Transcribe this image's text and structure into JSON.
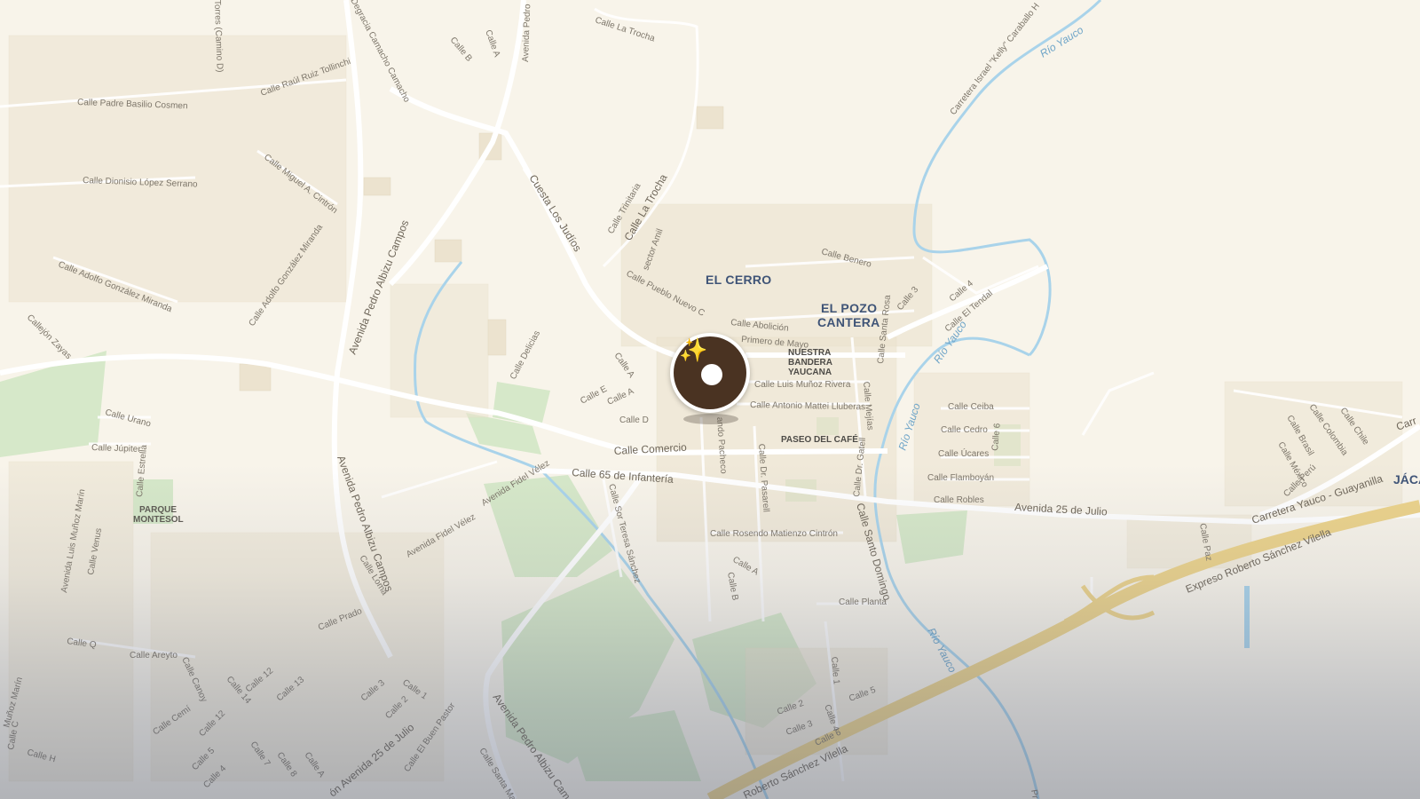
{
  "map": {
    "neighborhoods": [
      "EL CERRO",
      "EL POZO",
      "CANTERA"
    ],
    "town_edge_label": "JÁCA",
    "pois": {
      "nuestra_bandera": [
        "NUESTRA",
        "BANDERA",
        "YAUCANA"
      ],
      "paseo_del_cafe": "PASEO DEL CAFÉ",
      "parque_montesol": [
        "PARQUE",
        "MONTESOL"
      ]
    },
    "water": {
      "rio_yauco_1": "Río Yauco",
      "rio_yauco_2": "Río Yauco",
      "rio_yauco_3": "Río Yauco",
      "rio_yauco_4": "Río Yauco"
    },
    "streets": {
      "calle_la_trocha_top": "Calle La Trocha",
      "calle_b_top": "Calle B",
      "calle_a_top": "Calle A",
      "avenida_pedro_top": "Avenida Pedro",
      "torres": "Torres (Camino D)",
      "degracia": "Degracia Camacho Camacho",
      "raul_ruiz": "Calle Raúl Ruiz Tollinchi",
      "padre_basilio": "Calle Padre Basilio Cosmen",
      "carretera_kelly": "Carretera Israel \"Kelly\" Caraballo H",
      "dionisio": "Calle Dionisio López Serrano",
      "miguel_cintron": "Calle Miguel A. Cintrón",
      "cuesta_judios": "Cuesta Los Judíos",
      "calle_trinitaria": "Calle Trinitaria",
      "calle_la_trocha_mid": "Calle La Trocha",
      "sector_amil": "sector Amil",
      "avenida_pac_1": "Avenida Pedro Albizu Campos",
      "adolfo_gonzalez_1": "Calle Adolfo González Miranda",
      "adolfo_gonzalez_2": "Calle Adolfo González Miranda",
      "calle_benero": "Calle Benero",
      "pueblo_nuevo": "Calle Pueblo Nuevo C",
      "calle_abolicion": "Calle Abolición",
      "primero_mayo": "Primero de Mayo",
      "callejon_zayas": "Callejón Zayas",
      "calle_delicias": "Calle Delicias",
      "calle_a_mid1": "Calle A",
      "calle_e": "Calle E",
      "calle_a_mid2": "Calle A",
      "calle_d": "Calle D",
      "luis_munoz": "Calle Luis Muñoz Rivera",
      "antonio_mattei": "Calle Antonio Mattei Lluberas",
      "calle_santa_rosa": "Calle Santa Rosa",
      "calle_3_right": "Calle 3",
      "calle_4_right": "Calle 4",
      "calle_el_tendal": "Calle El Tendal",
      "calle_mejias": "Calle Mejías",
      "calle_ceiba": "Calle Ceiba",
      "calle_cedro": "Calle Cedro",
      "calle_6_right": "Calle 6",
      "calle_ucares": "Calle Úcares",
      "calle_flamboyan": "Calle Flamboyán",
      "calle_robles": "Calle Robles",
      "calle_urano": "Calle Urano",
      "calle_jupiter": "Calle Júpiter",
      "calle_estrella": "Calle Estrella",
      "calle_comercio": "Calle Comercio",
      "calle_65": "Calle 65 de Infantería",
      "ando_pacheco": "ando Pacheco",
      "dr_pasarell": "Calle Dr. Pasarell",
      "dr_gatell": "Calle Dr. Gatell",
      "santo_domingo": "Calle Santo Domingo",
      "avenida_25_julio": "Avenida 25 de Julio",
      "carretera_yauco": "Carretera Yauco - Guayanilla",
      "avenida_fidel_1": "Avenida Fidel Vélez",
      "avenida_fidel_2": "Avenida Fidel Vélez",
      "sor_teresa": "Calle Sor Teresa Sánchez",
      "rosendo": "Calle Rosendo Matienzo Cintrón",
      "avenida_pac_2": "Avenida Pedro Albizu Campos",
      "calle_loma": "Calle Loma",
      "calle_prado": "Calle Prado",
      "luis_munoz_marin": "Avenida Luis Muñoz Marín",
      "calle_venus": "Calle Venus",
      "calle_a_low": "Calle A",
      "calle_b_low": "Calle B",
      "calle_planta": "Calle Planta",
      "expreso_1": "Expreso Roberto Sánchez Vilella",
      "expreso_2": "Roberto Sánchez Vilella",
      "calle_q": "Calle Q",
      "calle_areyto": "Calle Areyto",
      "calle_canoy": "Calle Canoy",
      "calle_14": "Calle 14",
      "calle_12a": "Calle 12",
      "calle_13": "Calle 13",
      "calle_3_low": "Calle 3",
      "calle_1_low": "Calle 1",
      "calle_2_low": "Calle 2",
      "calle_cemi": "Calle Cemí",
      "calle_12b": "Calle 12",
      "calle_h": "Calle H",
      "calle_5_low": "Calle 5",
      "calle_4_low": "Calle 4",
      "calle_7_low": "Calle 7",
      "calle_8_low": "Calle 8",
      "calle_a_low2": "Calle A",
      "avenida_25_julio_low": "ón Avenida 25 de Julio",
      "buen_pastor": "Calle El Buen Pastor",
      "avenida_pac_3": "Avenida Pedro Albizu Cam",
      "calle_santa_mar": "Calle Santa Mar",
      "calle_1_right": "Calle 1",
      "calle_2_right": "Calle 2",
      "calle_4_right_low": "Calle 4",
      "calle_3_right_low": "Calle 3",
      "calle_6_right_low": "Calle 6",
      "calle_5_right_low": "Calle 5",
      "calle_paz": "Calle Paz",
      "calle_colombia": "Calle Colombia",
      "calle_chile": "Calle Chile",
      "calle_brasil": "Calle Brasil",
      "calle_mexico": "Calle México",
      "calle_peru": "Calle Perú",
      "calle_c_low": "Calle C",
      "munoz_marin_low": "Muñoz Marín",
      "carr_right": "Carr",
      "pr_low": "Pr"
    }
  },
  "pin": {
    "icon": "sparkles-icon",
    "glyph": "✨",
    "color": "#4a3322"
  },
  "colors": {
    "land": "#f8f4ea",
    "road": "#ffffff",
    "highway": "#ecd38b",
    "park": "#d6e8c9",
    "water": "#a9d3ea",
    "building": "#ece3cf"
  }
}
